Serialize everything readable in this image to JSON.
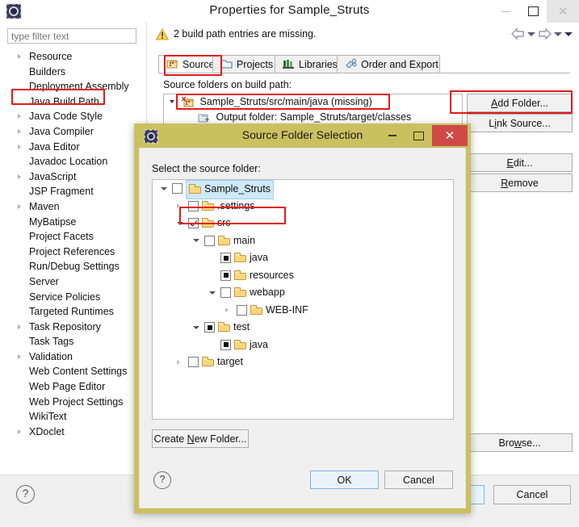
{
  "window": {
    "title": "Properties for Sample_Struts",
    "icon": "eclipse-icon",
    "minimize": "–",
    "maximize": "□",
    "close": "✕"
  },
  "filter": {
    "placeholder": "type filter text",
    "value": ""
  },
  "sidebar": {
    "items": [
      {
        "label": "Resource",
        "expandable": true,
        "highlighted": false
      },
      {
        "label": "Builders",
        "expandable": false,
        "highlighted": false
      },
      {
        "label": "Deployment Assembly",
        "expandable": false,
        "highlighted": false
      },
      {
        "label": "Java Build Path",
        "expandable": false,
        "highlighted": true
      },
      {
        "label": "Java Code Style",
        "expandable": true,
        "highlighted": false
      },
      {
        "label": "Java Compiler",
        "expandable": true,
        "highlighted": false
      },
      {
        "label": "Java Editor",
        "expandable": true,
        "highlighted": false
      },
      {
        "label": "Javadoc Location",
        "expandable": false,
        "highlighted": false
      },
      {
        "label": "JavaScript",
        "expandable": true,
        "highlighted": false
      },
      {
        "label": "JSP Fragment",
        "expandable": false,
        "highlighted": false
      },
      {
        "label": "Maven",
        "expandable": true,
        "highlighted": false
      },
      {
        "label": "MyBatipse",
        "expandable": false,
        "highlighted": false
      },
      {
        "label": "Project Facets",
        "expandable": false,
        "highlighted": false
      },
      {
        "label": "Project References",
        "expandable": false,
        "highlighted": false
      },
      {
        "label": "Run/Debug Settings",
        "expandable": false,
        "highlighted": false
      },
      {
        "label": "Server",
        "expandable": false,
        "highlighted": false
      },
      {
        "label": "Service Policies",
        "expandable": false,
        "highlighted": false
      },
      {
        "label": "Targeted Runtimes",
        "expandable": false,
        "highlighted": false
      },
      {
        "label": "Task Repository",
        "expandable": true,
        "highlighted": false
      },
      {
        "label": "Task Tags",
        "expandable": false,
        "highlighted": false
      },
      {
        "label": "Validation",
        "expandable": true,
        "highlighted": false
      },
      {
        "label": "Web Content Settings",
        "expandable": false,
        "highlighted": false
      },
      {
        "label": "Web Page Editor",
        "expandable": false,
        "highlighted": false
      },
      {
        "label": "Web Project Settings",
        "expandable": false,
        "highlighted": false
      },
      {
        "label": "WikiText",
        "expandable": false,
        "highlighted": false
      },
      {
        "label": "XDoclet",
        "expandable": true,
        "highlighted": false
      }
    ]
  },
  "message_bar": {
    "icon": "warning-icon",
    "text": "2 build path entries are missing.",
    "back": "back-arrow-icon",
    "forward": "forward-arrow-icon",
    "menu": "dropdown-caret-icon"
  },
  "tabs": [
    {
      "label": "Source",
      "icon": "source-folder-icon",
      "active": true
    },
    {
      "label": "Projects",
      "icon": "projects-icon",
      "active": false
    },
    {
      "label": "Libraries",
      "icon": "libraries-icon",
      "active": false
    },
    {
      "label": "Order and Export",
      "icon": "order-export-icon",
      "active": false
    }
  ],
  "source_tab": {
    "label": "Source folders on build path:",
    "entries": [
      {
        "text": "Sample_Struts/src/main/java (missing)",
        "icon": "missing-source-folder-icon",
        "indent": 1,
        "highlighted": true
      },
      {
        "text": "Output folder: Sample_Struts/target/classes",
        "icon": "output-folder-icon",
        "indent": 2,
        "highlighted": false
      }
    ],
    "buttons": [
      {
        "label": "Add Folder...",
        "mnemonic": "A",
        "highlighted": true
      },
      {
        "label": "Link Source...",
        "mnemonic": "i",
        "highlighted": false
      },
      {
        "label": "Edit...",
        "mnemonic": "E",
        "highlighted": false
      },
      {
        "label": "Remove",
        "mnemonic": "R",
        "highlighted": false
      }
    ],
    "browse_button": {
      "label": "Browse...",
      "mnemonic": "w"
    }
  },
  "footer": {
    "help": "?",
    "apply_label": "",
    "cancel_label": "Cancel"
  },
  "dialog": {
    "title": "Source Folder Selection",
    "icon": "eclipse-icon",
    "minimize": "–",
    "maximize": "□",
    "close": "✕",
    "prompt": "Select the source folder:",
    "tree": [
      {
        "label": "Sample_Struts",
        "indent": 0,
        "twisty": "open",
        "check": "unchecked",
        "selected": true,
        "highlighted": false
      },
      {
        "label": ".settings",
        "indent": 1,
        "twisty": "closed",
        "check": "unchecked",
        "selected": false,
        "highlighted": false
      },
      {
        "label": "src",
        "indent": 1,
        "twisty": "open",
        "check": "checked",
        "selected": false,
        "highlighted": true
      },
      {
        "label": "main",
        "indent": 2,
        "twisty": "open",
        "check": "unchecked",
        "selected": false,
        "highlighted": false
      },
      {
        "label": "java",
        "indent": 3,
        "twisty": "none",
        "check": "grey",
        "selected": false,
        "highlighted": false
      },
      {
        "label": "resources",
        "indent": 3,
        "twisty": "none",
        "check": "grey",
        "selected": false,
        "highlighted": false
      },
      {
        "label": "webapp",
        "indent": 3,
        "twisty": "open",
        "check": "unchecked",
        "selected": false,
        "highlighted": false
      },
      {
        "label": "WEB-INF",
        "indent": 4,
        "twisty": "closed",
        "check": "unchecked",
        "selected": false,
        "highlighted": false
      },
      {
        "label": "test",
        "indent": 2,
        "twisty": "open",
        "check": "grey",
        "selected": false,
        "highlighted": false
      },
      {
        "label": "java",
        "indent": 3,
        "twisty": "none",
        "check": "grey",
        "selected": false,
        "highlighted": false
      },
      {
        "label": "target",
        "indent": 1,
        "twisty": "closed",
        "check": "unchecked",
        "selected": false,
        "highlighted": false
      }
    ],
    "create_new_folder": {
      "label": "Create New Folder...",
      "mnemonic": "N"
    },
    "help": "?",
    "ok": "OK",
    "cancel": "Cancel"
  },
  "colors": {
    "dialog_frame": "#cbc05f",
    "highlight_outline": "#e01b1b",
    "close_button_red": "#cf4a46",
    "selection_blue": "#cfe9f7",
    "default_button_border": "#7eb4e2"
  }
}
